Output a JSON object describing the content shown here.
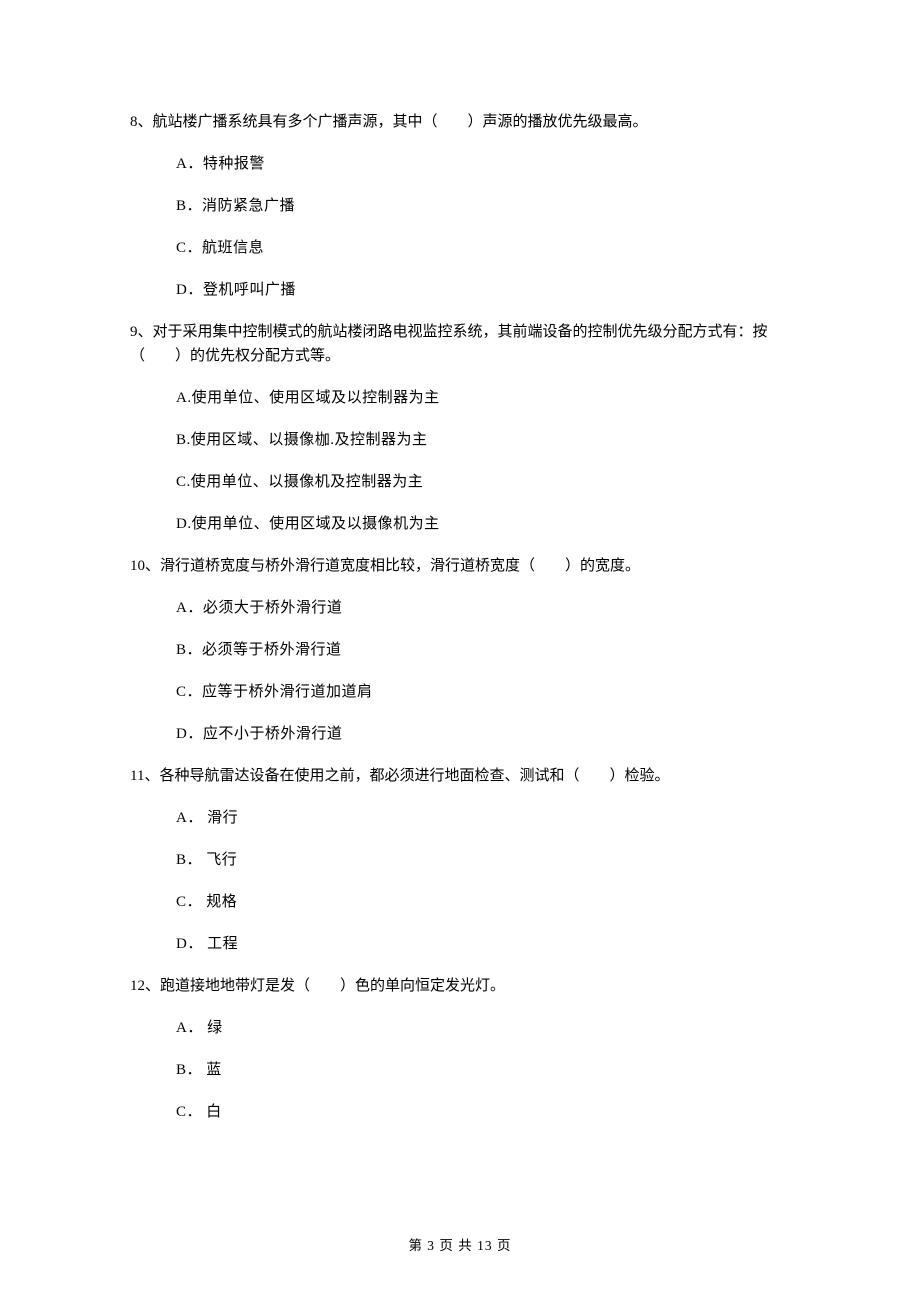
{
  "questions": [
    {
      "num": "8、",
      "stem": "航站楼广播系统具有多个广播声源，其中（　　）声源的播放优先级最高。",
      "options": [
        "A．特种报警",
        "B．消防紧急广播",
        "C．航班信息",
        "D．登机呼叫广播"
      ]
    },
    {
      "num": "9、",
      "stem": "对于采用集中控制模式的航站楼闭路电视监控系统，其前端设备的控制优先级分配方式有：按（　　）的优先权分配方式等。",
      "options": [
        "A.使用单位、使用区域及以控制器为主",
        "B.使用区域、以摄像枷.及控制器为主",
        "C.使用单位、以摄像机及控制器为主",
        "D.使用单位、使用区域及以摄像机为主"
      ]
    },
    {
      "num": "10、",
      "stem": "滑行道桥宽度与桥外滑行道宽度相比较，滑行道桥宽度（　　）的宽度。",
      "options": [
        "A．必须大于桥外滑行道",
        "B．必须等于桥外滑行道",
        "C．应等于桥外滑行道加道肩",
        "D．应不小于桥外滑行道"
      ]
    },
    {
      "num": "11、",
      "stem": "各种导航雷达设备在使用之前，都必须进行地面检查、测试和（　　）检验。",
      "options": [
        "A． 滑行",
        "B． 飞行",
        "C． 规格",
        "D． 工程"
      ]
    },
    {
      "num": "12、",
      "stem": "跑道接地地带灯是发（　　）色的单向恒定发光灯。",
      "options": [
        "A． 绿",
        "B． 蓝",
        "C． 白"
      ]
    }
  ],
  "footer": "第 3 页 共 13 页"
}
